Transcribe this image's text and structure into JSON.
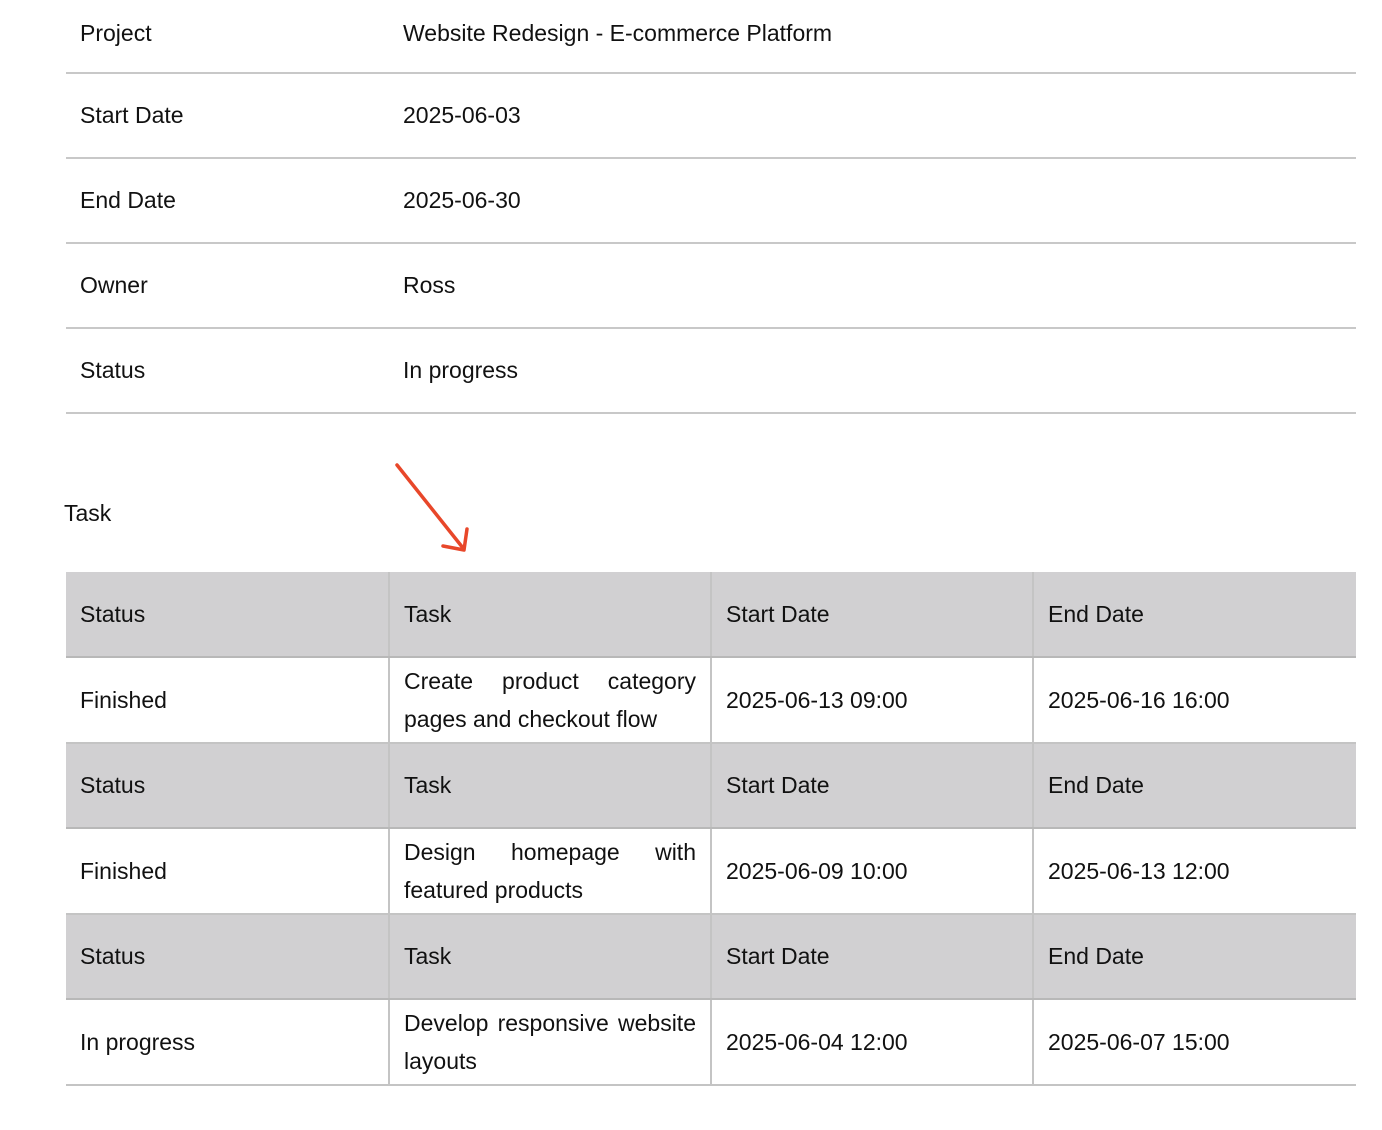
{
  "project_info": [
    {
      "label": "Project",
      "value": "Website Redesign - E-commerce Platform"
    },
    {
      "label": "Start Date",
      "value": "2025-06-03"
    },
    {
      "label": "End Date",
      "value": "2025-06-30"
    },
    {
      "label": "Owner",
      "value": "Ross"
    },
    {
      "label": "Status",
      "value": "In progress"
    }
  ],
  "task_section": {
    "heading": "Task",
    "annotation_color": "#e8472a",
    "header_bg_color": "#d1d0d2",
    "columns": [
      "Status",
      "Task",
      "Start Date",
      "End Date"
    ],
    "rows": [
      {
        "status": "Finished",
        "task": "Create product category pages and checkout flow",
        "start": "2025-06-13 09:00",
        "end": "2025-06-16 16:00"
      },
      {
        "status": "Finished",
        "task": "Design homepage with featured products",
        "start": "2025-06-09 10:00",
        "end": "2025-06-13 12:00"
      },
      {
        "status": "In progress",
        "task": "Develop responsive website layouts",
        "start": "2025-06-04 12:00",
        "end": "2025-06-07 15:00"
      }
    ]
  }
}
